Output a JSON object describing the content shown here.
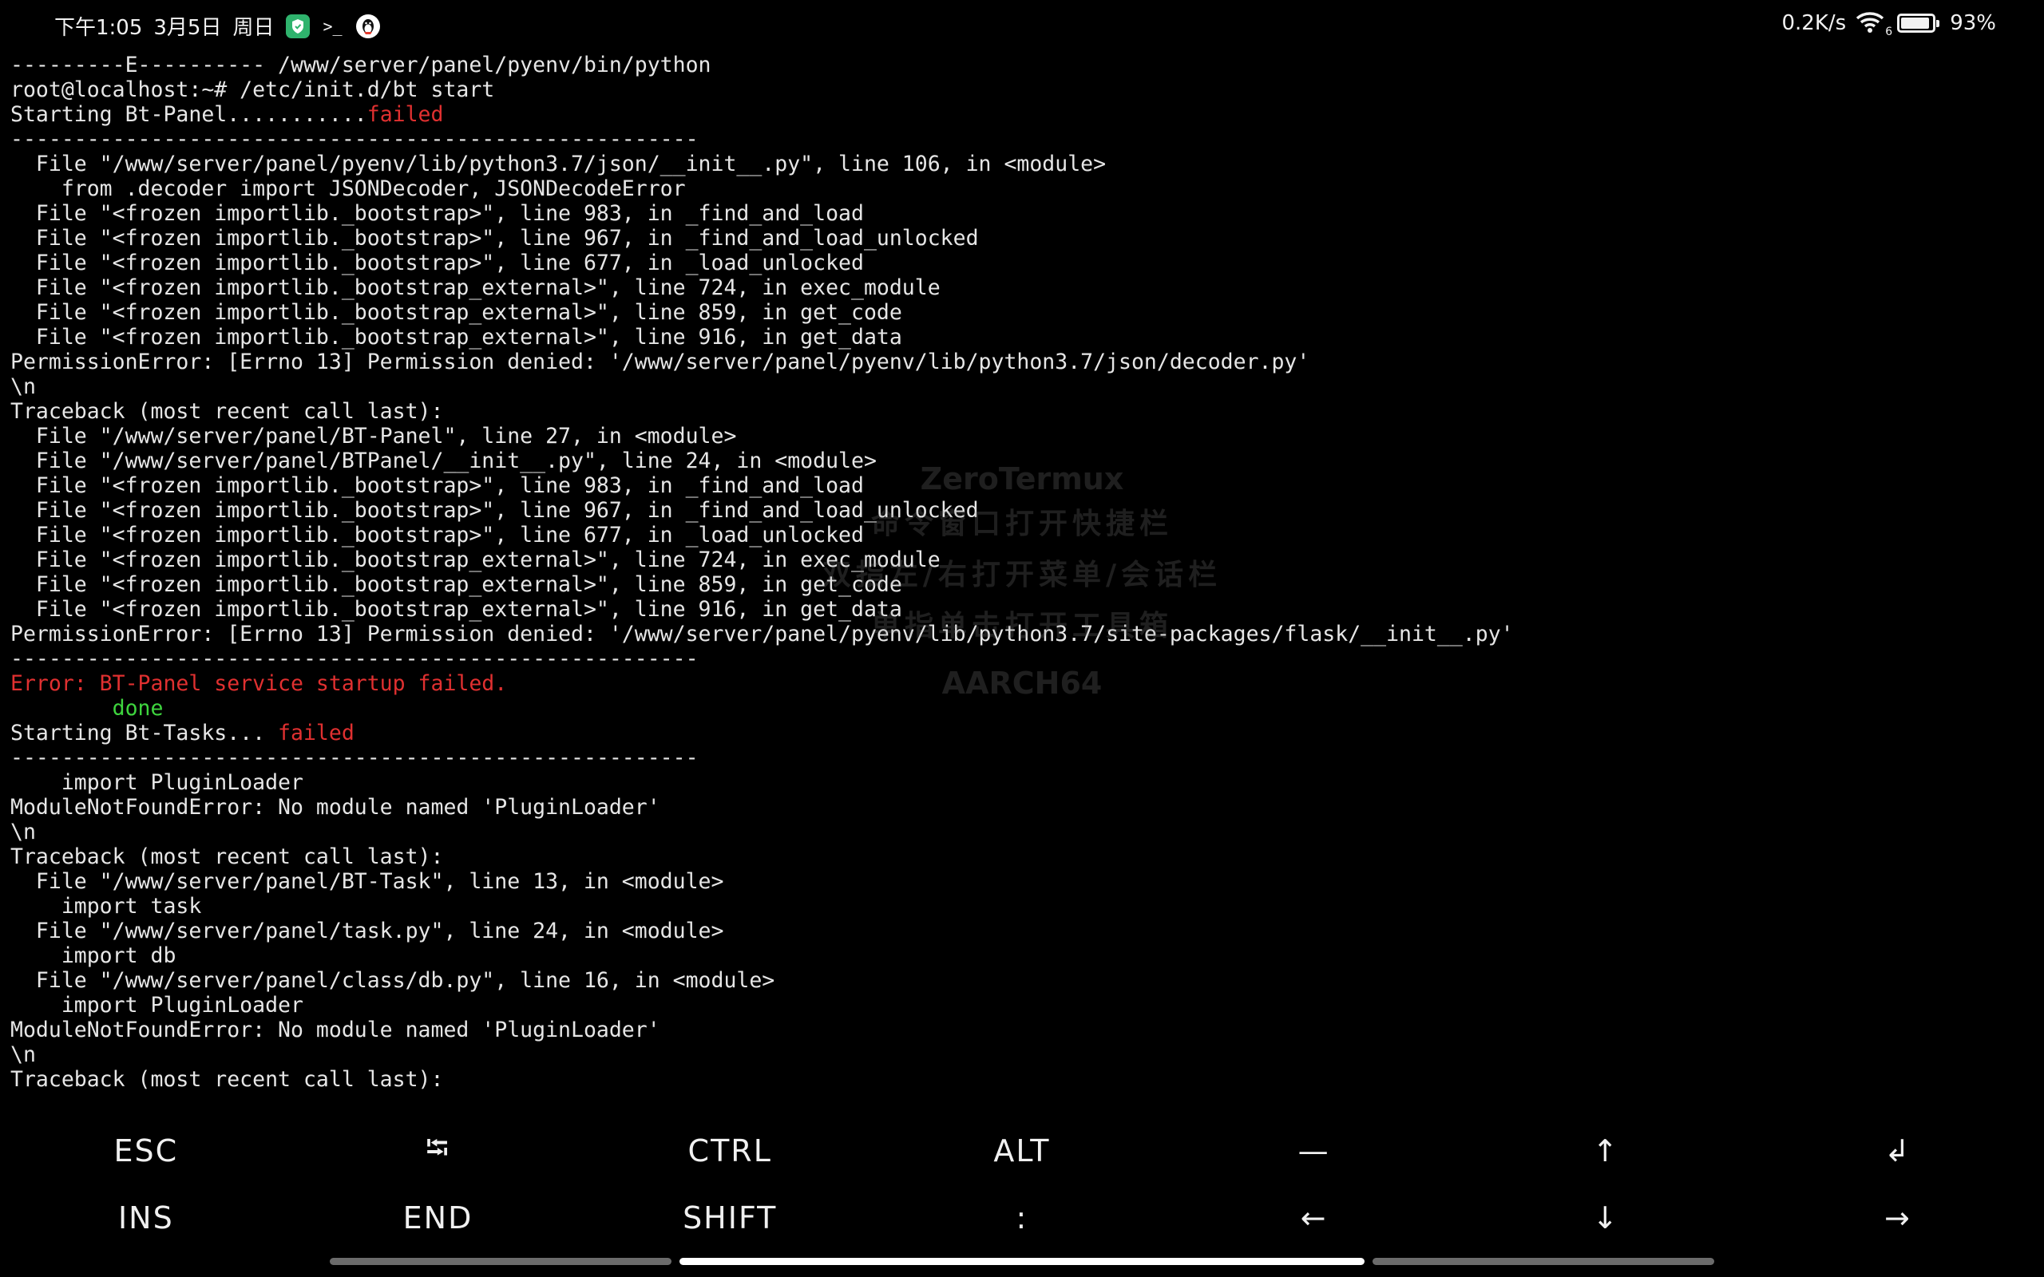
{
  "status_bar": {
    "time_text": "下午1:05",
    "date_text": "3月5日",
    "weekday_text": "周日",
    "app_icons": [
      "shield-app-icon",
      "terminal-prompt-icon",
      "qq-penguin-icon"
    ],
    "terminal_prompt_glyph": ">_",
    "net_speed": "0.2K/s",
    "wifi_badge": "6",
    "battery_percent": "93%",
    "battery_level": 0.93
  },
  "terminal": {
    "lines": [
      [
        {
          "t": "---------E---------- /www/server/panel/pyenv/bin/python"
        }
      ],
      [
        {
          "t": "root@localhost:~# /etc/init.d/bt start"
        }
      ],
      [
        {
          "t": "Starting Bt-Panel..........."
        },
        {
          "t": "failed",
          "c": "red"
        }
      ],
      [
        {
          "t": "------------------------------------------------------"
        }
      ],
      [
        {
          "t": "  File \"/www/server/panel/pyenv/lib/python3.7/json/__init__.py\", line 106, in <module>"
        }
      ],
      [
        {
          "t": "    from .decoder import JSONDecoder, JSONDecodeError"
        }
      ],
      [
        {
          "t": "  File \"<frozen importlib._bootstrap>\", line 983, in _find_and_load"
        }
      ],
      [
        {
          "t": "  File \"<frozen importlib._bootstrap>\", line 967, in _find_and_load_unlocked"
        }
      ],
      [
        {
          "t": "  File \"<frozen importlib._bootstrap>\", line 677, in _load_unlocked"
        }
      ],
      [
        {
          "t": "  File \"<frozen importlib._bootstrap_external>\", line 724, in exec_module"
        }
      ],
      [
        {
          "t": "  File \"<frozen importlib._bootstrap_external>\", line 859, in get_code"
        }
      ],
      [
        {
          "t": "  File \"<frozen importlib._bootstrap_external>\", line 916, in get_data"
        }
      ],
      [
        {
          "t": "PermissionError: [Errno 13] Permission denied: '/www/server/panel/pyenv/lib/python3.7/json/decoder.py'"
        }
      ],
      [
        {
          "t": "\\n"
        }
      ],
      [
        {
          "t": "Traceback (most recent call last):"
        }
      ],
      [
        {
          "t": "  File \"/www/server/panel/BT-Panel\", line 27, in <module>"
        }
      ],
      [
        {
          "t": "  File \"/www/server/panel/BTPanel/__init__.py\", line 24, in <module>"
        }
      ],
      [
        {
          "t": "  File \"<frozen importlib._bootstrap>\", line 983, in _find_and_load"
        }
      ],
      [
        {
          "t": "  File \"<frozen importlib._bootstrap>\", line 967, in _find_and_load_unlocked"
        }
      ],
      [
        {
          "t": "  File \"<frozen importlib._bootstrap>\", line 677, in _load_unlocked"
        }
      ],
      [
        {
          "t": "  File \"<frozen importlib._bootstrap_external>\", line 724, in exec_module"
        }
      ],
      [
        {
          "t": "  File \"<frozen importlib._bootstrap_external>\", line 859, in get_code"
        }
      ],
      [
        {
          "t": "  File \"<frozen importlib._bootstrap_external>\", line 916, in get_data"
        }
      ],
      [
        {
          "t": "PermissionError: [Errno 13] Permission denied: '/www/server/panel/pyenv/lib/python3.7/site-packages/flask/__init__.py'"
        }
      ],
      [
        {
          "t": "------------------------------------------------------"
        }
      ],
      [
        {
          "t": "Error: BT-Panel service startup failed.",
          "c": "red"
        }
      ],
      [
        {
          "t": "        "
        },
        {
          "t": "done",
          "c": "green"
        }
      ],
      [
        {
          "t": "Starting Bt-Tasks... "
        },
        {
          "t": "failed",
          "c": "red"
        }
      ],
      [
        {
          "t": "------------------------------------------------------"
        }
      ],
      [
        {
          "t": "    import PluginLoader"
        }
      ],
      [
        {
          "t": "ModuleNotFoundError: No module named 'PluginLoader'"
        }
      ],
      [
        {
          "t": "\\n"
        }
      ],
      [
        {
          "t": "Traceback (most recent call last):"
        }
      ],
      [
        {
          "t": "  File \"/www/server/panel/BT-Task\", line 13, in <module>"
        }
      ],
      [
        {
          "t": "    import task"
        }
      ],
      [
        {
          "t": "  File \"/www/server/panel/task.py\", line 24, in <module>"
        }
      ],
      [
        {
          "t": "    import db"
        }
      ],
      [
        {
          "t": "  File \"/www/server/panel/class/db.py\", line 16, in <module>"
        }
      ],
      [
        {
          "t": "    import PluginLoader"
        }
      ],
      [
        {
          "t": "ModuleNotFoundError: No module named 'PluginLoader'"
        }
      ],
      [
        {
          "t": "\\n"
        }
      ],
      [
        {
          "t": "Traceback (most recent call last):"
        }
      ]
    ]
  },
  "watermark": {
    "title": "ZeroTermux",
    "line1": "命令窗口打开快捷栏",
    "line2": "双指左/右打开菜单/会话栏",
    "line3": "单指单击打开工具箱",
    "arch": "AARCH64"
  },
  "extra_keys": {
    "row1": [
      {
        "name": "esc-key",
        "label": "ESC"
      },
      {
        "name": "tab-key",
        "label": "⭾"
      },
      {
        "name": "ctrl-key",
        "label": "CTRL"
      },
      {
        "name": "alt-key",
        "label": "ALT"
      },
      {
        "name": "dash-key",
        "label": "—"
      },
      {
        "name": "up-arrow-key",
        "label": "↑"
      },
      {
        "name": "enter-key",
        "label": "↲"
      }
    ],
    "row2": [
      {
        "name": "ins-key",
        "label": "INS"
      },
      {
        "name": "end-key",
        "label": "END"
      },
      {
        "name": "shift-key",
        "label": "SHIFT"
      },
      {
        "name": "colon-key",
        "label": ":"
      },
      {
        "name": "left-arrow-key",
        "label": "←"
      },
      {
        "name": "down-arrow-key",
        "label": "↓"
      },
      {
        "name": "right-arrow-key",
        "label": "→"
      }
    ]
  },
  "colors": {
    "error_red": "#e03030",
    "done_green": "#3ed53e",
    "text": "#e6e6e6",
    "background": "#000000"
  }
}
